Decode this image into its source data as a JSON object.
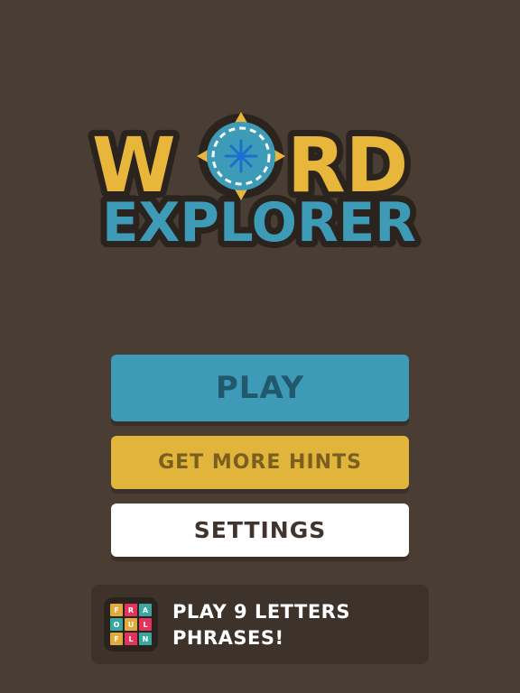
{
  "logo": {
    "word1_start": "W",
    "word1_end": "RD",
    "word2": "EXPLORER",
    "compass_icon": "compass-icon"
  },
  "menu": {
    "play_label": "PLAY",
    "hints_label": "GET MORE HINTS",
    "settings_label": "SETTINGS"
  },
  "promo": {
    "line1": "PLAY 9 LETTERS",
    "line2": "PHRASES!",
    "tiles": [
      "F",
      "R",
      "A",
      "O",
      "U",
      "L",
      "F",
      "L",
      "N"
    ],
    "tile_colors": [
      "#e2a93b",
      "#e3335d",
      "#3aa6a0",
      "#3aa6a0",
      "#e2a93b",
      "#e3335d",
      "#e2a93b",
      "#e3335d",
      "#3aa6a0"
    ]
  },
  "colors": {
    "background": "#4a3d34",
    "play": "#3e9bb8",
    "hints": "#e1b43c",
    "settings": "#ffffff",
    "logo_yellow": "#e8b63a",
    "logo_blue": "#3e9bb8"
  }
}
